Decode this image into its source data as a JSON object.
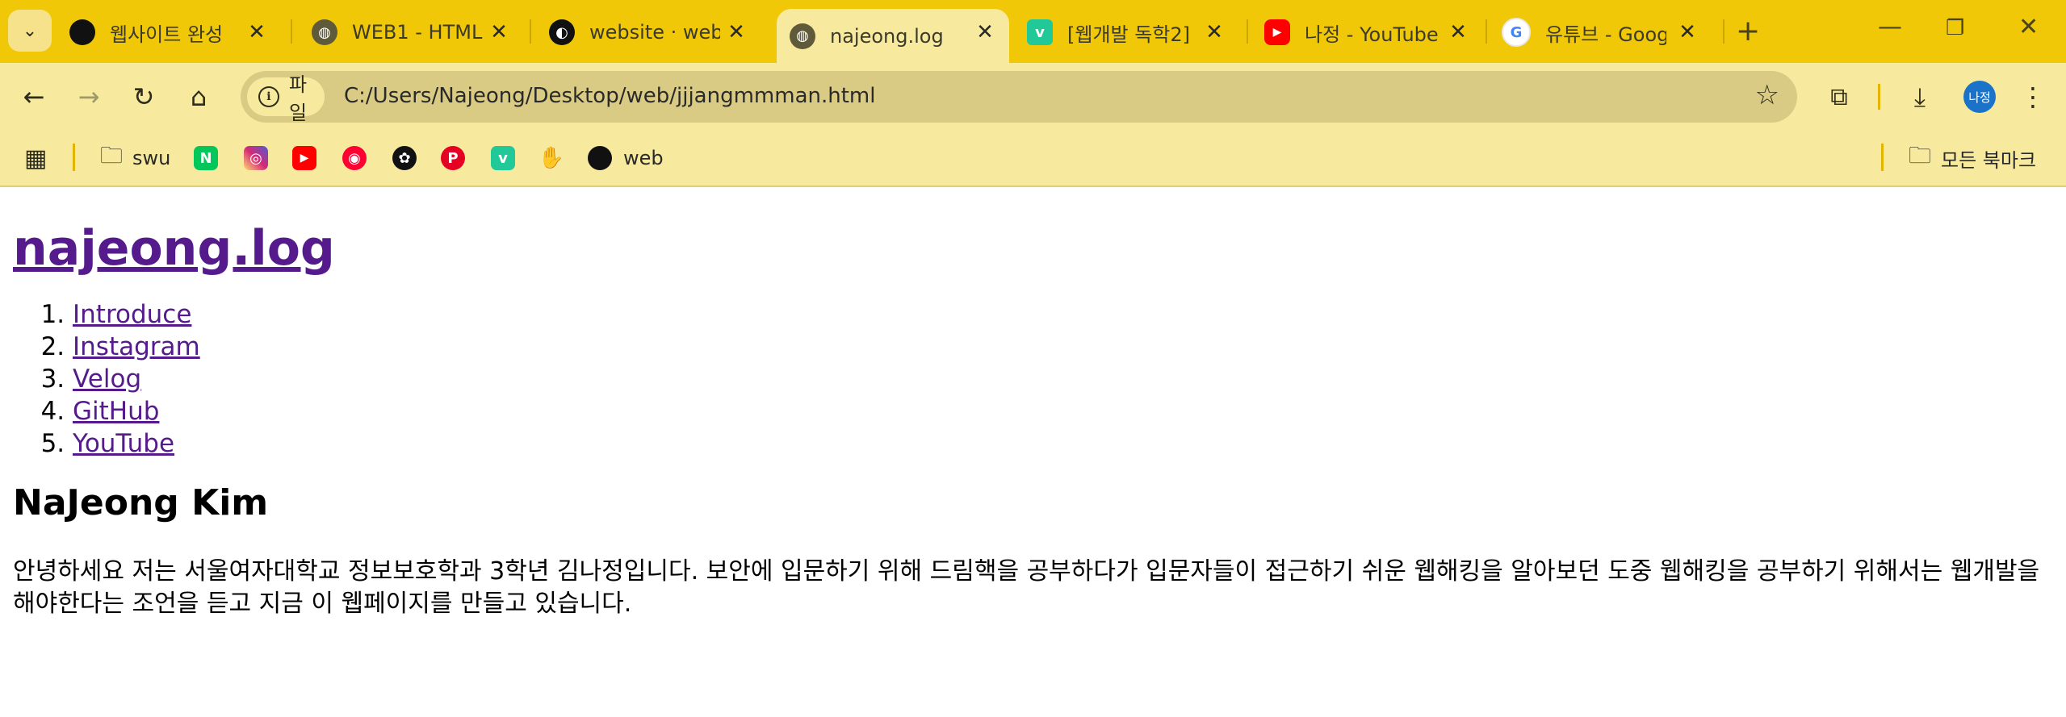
{
  "browser": {
    "tabs": [
      {
        "title": "웹사이트 완성",
        "favicon": "black-circle-icon",
        "color": "#111111",
        "active": false
      },
      {
        "title": "WEB1 - HTML",
        "favicon": "globe-icon",
        "color": "#5f5a3a",
        "active": false
      },
      {
        "title": "website · web-r",
        "favicon": "github-icon",
        "color": "#111111",
        "active": false
      },
      {
        "title": "najeong.log",
        "favicon": "globe-icon",
        "color": "#5f5a3a",
        "active": true
      },
      {
        "title": "[웹개발 독학2]",
        "favicon": "velog-icon",
        "color": "#20c997",
        "active": false
      },
      {
        "title": "나정 - YouTube",
        "favicon": "youtube-icon",
        "color": "#ff0000",
        "active": false
      },
      {
        "title": "유튜브 - Googl",
        "favicon": "google-icon",
        "color": "#4285f4",
        "active": false
      }
    ],
    "address": {
      "chip_label": "파일",
      "url": "C:/Users/Najeong/Desktop/web/jjjangmmman.html"
    },
    "avatar_label": "나정",
    "bookmarks": [
      {
        "label": "swu",
        "icon": "folder-icon"
      },
      {
        "label": "",
        "icon": "naver-icon",
        "glyph": "N",
        "color": "#03c75a"
      },
      {
        "label": "",
        "icon": "instagram-icon",
        "glyph": "◎",
        "color": "#d62976"
      },
      {
        "label": "",
        "icon": "youtube-icon",
        "glyph": "▶",
        "color": "#ff0000"
      },
      {
        "label": "",
        "icon": "youtube-music-icon",
        "glyph": "◉",
        "color": "#ff0033"
      },
      {
        "label": "",
        "icon": "chatgpt-icon",
        "glyph": "✿",
        "color": "#111111"
      },
      {
        "label": "",
        "icon": "pinterest-icon",
        "glyph": "P",
        "color": "#e60023"
      },
      {
        "label": "",
        "icon": "velog-icon",
        "glyph": "v",
        "color": "#20c997"
      },
      {
        "label": "",
        "icon": "hand-icon",
        "glyph": "✋",
        "color": "#f5b400"
      },
      {
        "label": "web",
        "icon": "black-circle-icon",
        "glyph": "",
        "color": "#111111"
      }
    ],
    "all_bookmarks_label": "모든 북마크"
  },
  "page": {
    "title": "najeong.log",
    "nav": [
      "Introduce",
      "Instagram",
      "Velog",
      "GitHub",
      "YouTube"
    ],
    "heading": "NaJeong Kim",
    "paragraph": "안녕하세요 저는 서울여자대학교 정보보호학과 3학년 김나정입니다. 보안에 입문하기 위해 드림핵을 공부하다가 입문자들이 접근하기 쉬운 웹해킹을 알아보던 도중 웹해킹을 공부하기 위해서는 웹개발을 해야한다는 조언을 듣고 지금 이 웹페이지를 만들고 있습니다."
  }
}
